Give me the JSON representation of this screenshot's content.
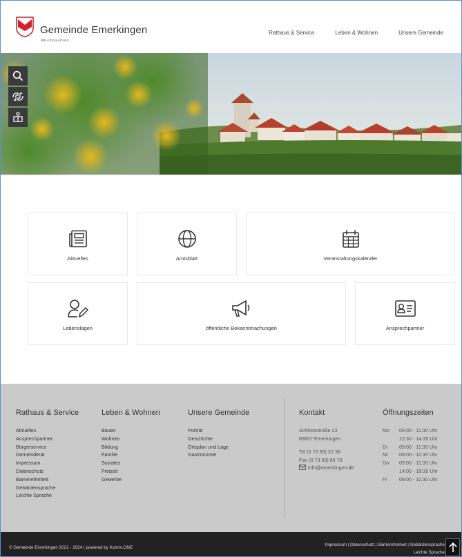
{
  "header": {
    "brand": "Gemeinde Emerkingen",
    "subtitle": "Alb-Donau-Kreis",
    "nav": [
      "Rathaus & Service",
      "Leben & Wohnen",
      "Unsere Gemeinde"
    ]
  },
  "hero": {
    "tools": [
      "search-icon",
      "sign-language-icon",
      "easy-language-icon"
    ]
  },
  "tiles": [
    {
      "label": "Aktuelles",
      "icon": "newspaper-icon"
    },
    {
      "label": "Amtsblatt",
      "icon": "globe-icon"
    },
    {
      "label": "Veranstaltungskalender",
      "icon": "calendar-icon"
    },
    {
      "label": "Lebenslagen",
      "icon": "user-edit-icon"
    },
    {
      "label": "öffentliche Bekanntmachungen",
      "icon": "megaphone-icon"
    },
    {
      "label": "Ansprechpartner",
      "icon": "contact-card-icon"
    }
  ],
  "footer": {
    "rathaus": {
      "title": "Rathaus & Service",
      "links": [
        "Aktuelles",
        "Ansprechpartner",
        "Bürgerservice",
        "Gemeinderat",
        "Impressum",
        "Datenschutz",
        "Barrierefreiheit",
        "Gebärdensprache",
        "Leichte Sprache"
      ]
    },
    "leben": {
      "title": "Leben & Wohnen",
      "links": [
        "Bauen",
        "Wohnen",
        "Bildung",
        "Familie",
        "Soziales",
        "Freizeit",
        "Gewerbe"
      ]
    },
    "gemeinde": {
      "title": "Unsere Gemeinde",
      "links": [
        "Porträt",
        "Geschichte",
        "Ortsplan und Lage",
        "Gastronomie"
      ]
    },
    "kontakt": {
      "title": "Kontakt",
      "street": "Schlossstraße 23",
      "city": "89607 Emerkingen",
      "tel": "Tel (0 73 93) 22 39",
      "fax": "Fax (0 73 93) 65 78",
      "email": "info@emerkingen.de"
    },
    "hours": {
      "title": "Öffnungszeiten",
      "rows": [
        {
          "day": "Mo",
          "time": "09:00 - 11:30 Uhr"
        },
        {
          "day": "",
          "time": "12:30 - 14:30 Uhr"
        },
        {
          "day": "Di",
          "time": "09:00 - 11:30 Uhr"
        },
        {
          "day": "Mi",
          "time": "09:00 - 11:30 Uhr"
        },
        {
          "day": "Do",
          "time": "09:00 - 11:30 Uhr"
        },
        {
          "day": "",
          "time": "14:00 - 18:30 Uhr"
        },
        {
          "day": "Fr",
          "time": "09:00 - 11:30 Uhr"
        }
      ]
    }
  },
  "bottom": {
    "copyright": "© Gemeinde Emerkingen 2021 - 2024 | powered by Komm.ONE",
    "links_line1": "Impressum | Datenschutz | Barrierefreiheit | Gebärdensprache",
    "links_line2": "Leichte Sprache"
  },
  "colors": {
    "accent_red": "#d8202a",
    "footer_bg": "#cacaca",
    "bottom_bg": "#222222",
    "tool_bg": "#3a3a3a"
  }
}
